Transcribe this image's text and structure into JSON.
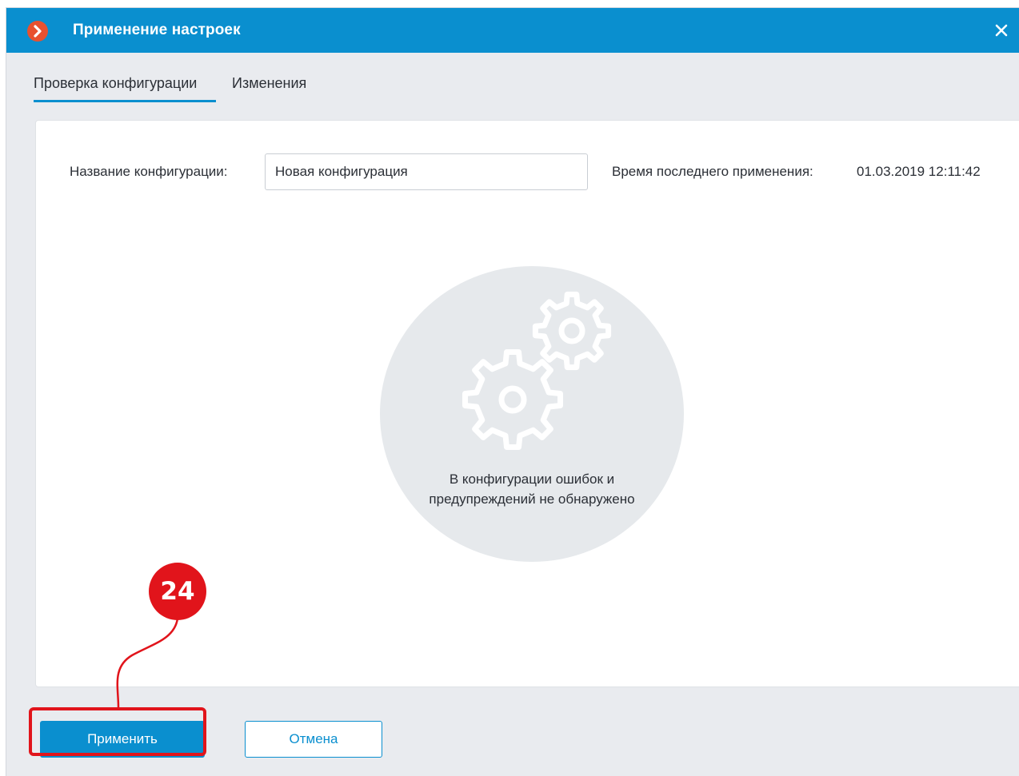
{
  "window": {
    "title": "Применение настроек",
    "close_glyph": "✕"
  },
  "tabs": [
    {
      "label": "Проверка конфигурации",
      "active": true
    },
    {
      "label": "Изменения",
      "active": false
    }
  ],
  "config": {
    "name_label": "Название конфигурации:",
    "name_value": "Новая конфигурация",
    "last_applied_label": "Время последнего применения:",
    "last_applied_value": "01.03.2019 12:11:42"
  },
  "status": {
    "icon": "gears-icon",
    "message": "В конфигурации ошибок и предупреждений не обнаружено"
  },
  "buttons": {
    "apply_label": "Применить",
    "cancel_label": "Отмена"
  },
  "annotation": {
    "badge_number": "24"
  },
  "colors": {
    "accent": "#0a8fcf",
    "title_bar": "#0a8fcf",
    "logo": "#e8512f",
    "annotation": "#e1141b",
    "background": "#e9ebef"
  }
}
